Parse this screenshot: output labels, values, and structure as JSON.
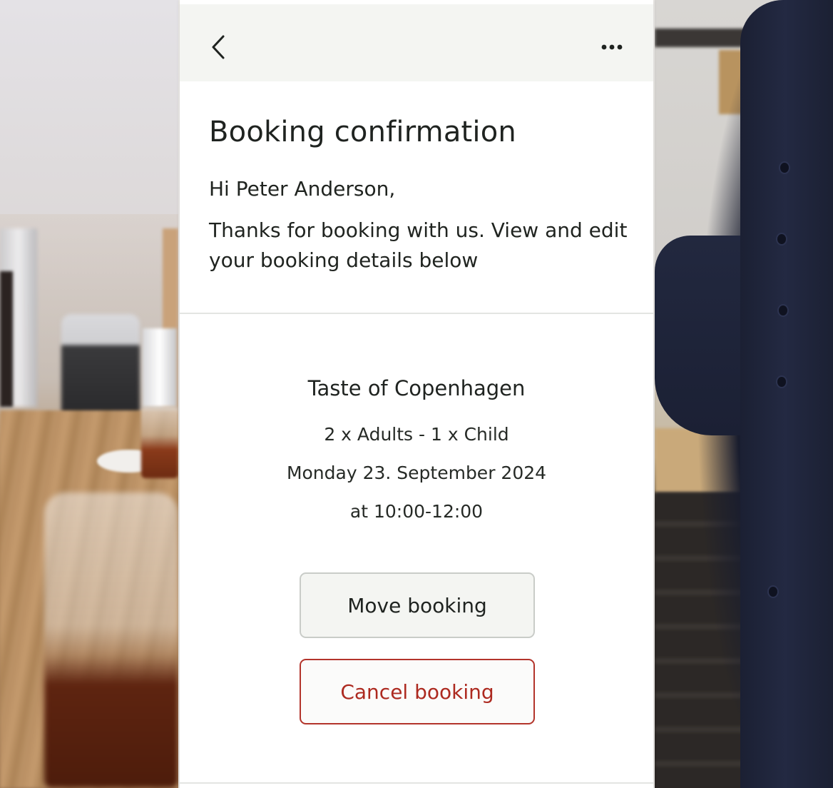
{
  "header": {
    "back_icon": "chevron-left-icon",
    "more_icon": "ellipsis-horizontal-icon"
  },
  "page": {
    "title": "Booking confirmation",
    "greeting": "Hi Peter Anderson,",
    "intro": "Thanks for booking with us. View and edit your booking details below"
  },
  "booking": {
    "event_name": "Taste of Copenhagen",
    "guests": "2 x Adults - 1 x Child",
    "date": "Monday 23. September 2024",
    "time": "at 10:00-12:00"
  },
  "actions": {
    "move_label": "Move booking",
    "cancel_label": "Cancel booking"
  },
  "colors": {
    "topbar_bg": "#f4f5f2",
    "text": "#1f2320",
    "cancel_accent": "#b3342b",
    "divider": "#e3e5e2"
  }
}
